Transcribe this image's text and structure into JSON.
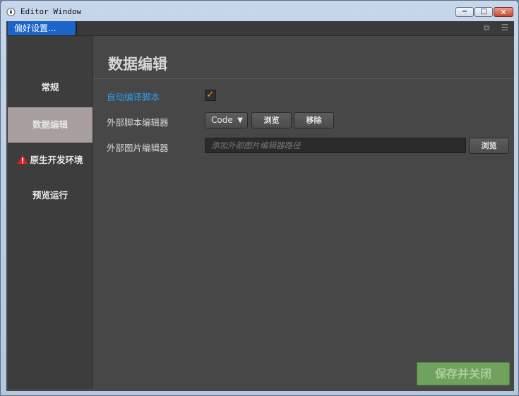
{
  "window": {
    "title": "Editor Window"
  },
  "tabs": {
    "active_label": "偏好设置..."
  },
  "sidebar": {
    "items": [
      {
        "label": "常规"
      },
      {
        "label": "数据编辑"
      },
      {
        "label": "原生开发环境"
      },
      {
        "label": "预览运行"
      }
    ]
  },
  "main": {
    "title": "数据编辑",
    "auto_compile": {
      "label": "自动编译脚本",
      "checked": true
    },
    "script_editor": {
      "label": "外部脚本编辑器",
      "dropdown_value": "Code",
      "browse_label": "浏览",
      "remove_label": "移除"
    },
    "image_editor": {
      "label": "外部图片编辑器",
      "placeholder": "添加外部图片编辑器路径",
      "browse_label": "浏览"
    },
    "save_label": "保存并关闭"
  },
  "colors": {
    "accent_blue": "#2a9df4",
    "checkbox_orange": "#f0a03c",
    "save_green": "#6fa25d",
    "active_sidebar": "#a99e9e"
  }
}
